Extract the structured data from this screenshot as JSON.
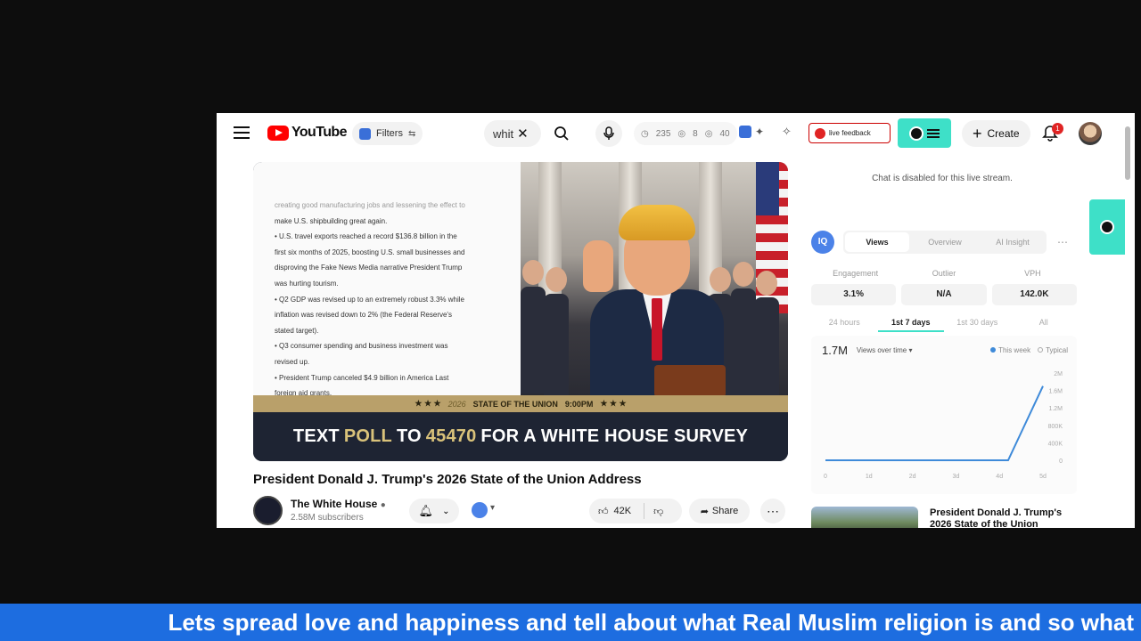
{
  "window": {
    "logo_text": "YouTube",
    "filters_label": "Filters",
    "search_value": "whit",
    "stats": [
      "235",
      "8",
      "40"
    ],
    "feedback_label": "live feedback",
    "create_label": "Create",
    "notification_count": "1"
  },
  "video": {
    "doc_lines_faded": "creating good manufacturing jobs and lessening the effect to",
    "doc_lines": [
      "make U.S. shipbuilding great again.",
      "• U.S. travel exports reached a record $136.8 billion in the",
      "first six months of 2025, boosting U.S. small businesses and",
      "disproving the Fake News Media narrative President Trump",
      "was hurting tourism.",
      "• Q2 GDP was revised up to an extremely robust 3.3% while",
      "inflation was revised down to 2% (the Federal Reserve's",
      "stated target).",
      "• Q3 consumer spending and business investment was",
      "revised up.",
      "• President Trump canceled $4.9 billion in America Last",
      "foreign aid grants."
    ],
    "gold_stars_left": "★ ★ ★",
    "gold_prefix": "2026",
    "gold_main": "STATE OF THE UNION",
    "gold_time": "9:00PM",
    "gold_stars_right": "★ ★ ★",
    "banner": {
      "part1": "TEXT",
      "part2": "POLL",
      "part3": "TO",
      "part4": "45470",
      "part5": "FOR A WHITE HOUSE SURVEY"
    },
    "title": "President Donald J. Trump's 2026 State of the Union Address",
    "channel_name": "The White House",
    "channel_subs": "2.58M subscribers",
    "like_count": "42K",
    "share_label": "Share"
  },
  "panel": {
    "chat_disabled": "Chat is disabled for this live stream.",
    "tabs": [
      "Views",
      "Overview",
      "AI Insight"
    ],
    "metric_labels": [
      "Engagement",
      "Outlier",
      "VPH"
    ],
    "metric_values": [
      "3.1%",
      "N/A",
      "142.0K"
    ],
    "ranges": [
      "24 hours",
      "1st 7 days",
      "1st 30 days",
      "All"
    ],
    "chart_total": "1.7M",
    "chart_dropdown": "Views over time",
    "legend": [
      "This week",
      "Typical"
    ],
    "next_title": "President Donald J. Trump's 2026 State of the Union"
  },
  "chart_data": {
    "type": "line",
    "x": [
      "0",
      "1d",
      "2d",
      "3d",
      "4d",
      "5d"
    ],
    "series": [
      {
        "name": "This week",
        "values": [
          0,
          0,
          0,
          0,
          0,
          1.7
        ]
      }
    ],
    "y_ticks": [
      "0",
      "400K",
      "800K",
      "1.2M",
      "1.6M",
      "2M"
    ],
    "ylim": [
      0,
      2
    ]
  },
  "ticker": {
    "text": "Lets spread love and happiness and tell about what Real Muslim religion is and so what"
  },
  "colors": {
    "accent_teal": "#3ee0c8",
    "ticker_blue": "#1d6de0",
    "line_blue": "#3e8ad9"
  }
}
